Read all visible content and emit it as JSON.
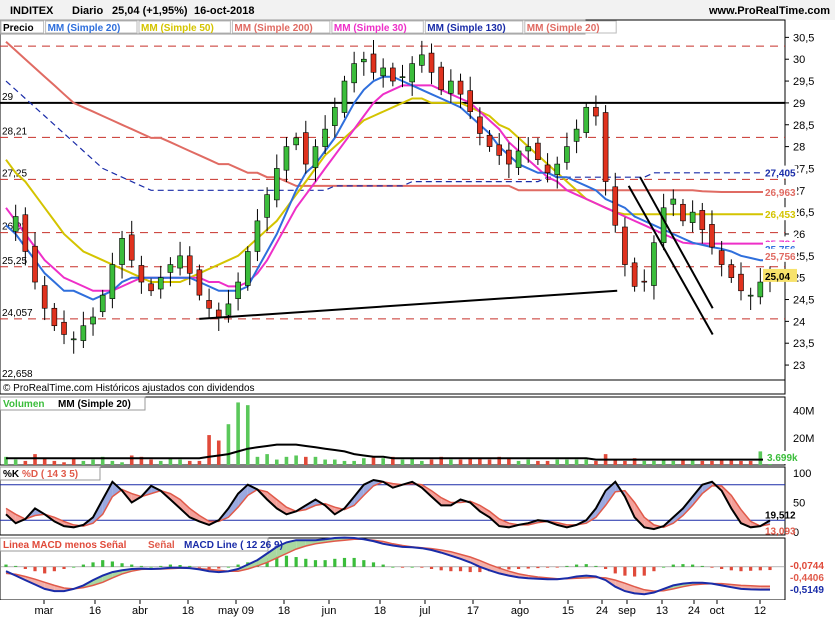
{
  "header": {
    "ticker": "INDITEX",
    "period": "Diario",
    "last": "25,04 (+1,95%)",
    "date": "16-oct-2018",
    "site": "www.ProRealTime.com"
  },
  "price_legend": [
    {
      "label": "Precio",
      "color": "#000000"
    },
    {
      "label": "MM (Simple 20)",
      "color": "#2f6fdc"
    },
    {
      "label": "MM (Simple 50)",
      "color": "#d4c400"
    },
    {
      "label": "MM (Simple 200)",
      "color": "#e06b63"
    },
    {
      "label": "MM (Simple 30)",
      "color": "#ee2fc8"
    },
    {
      "label": "MM (Simple 130)",
      "color": "#1a2ca8"
    },
    {
      "label": "MM (Simple 20)",
      "color": "#e06b63"
    }
  ],
  "footer_note": "© ProRealTime.com  Históricos ajustados con dividendos",
  "volume_legend": {
    "label": "Volumen",
    "ma": "MM (Simple 20)"
  },
  "stoch_legend": {
    "k": "%K",
    "d": "%D ( 14 3 5)"
  },
  "macd_legend": {
    "line1": "Linea MACD menos Señal",
    "line2": "Señal",
    "line3": "MACD Line ( 12 26 9)"
  },
  "chart_data": [
    {
      "type": "candlestick",
      "title": "INDITEX Diario",
      "ylim": [
        22.658,
        30.6
      ],
      "yticks": [
        "30,5",
        "30",
        "29,5",
        "29",
        "28,5",
        "28",
        "27,5",
        "27",
        "26,5",
        "26",
        "25,5",
        "25",
        "24,5",
        "24",
        "23,5",
        "23"
      ],
      "ytick_values": [
        30.5,
        30,
        29.5,
        29,
        28.5,
        28,
        27.5,
        27,
        26.5,
        26,
        25.5,
        25,
        24.5,
        24,
        23.5,
        23
      ],
      "xticks": [
        "mar",
        "16",
        "abr",
        "18",
        "may 09",
        "18",
        "jun",
        "18",
        "jul",
        "17",
        "ago",
        "15",
        "24",
        "sep",
        "13",
        "24",
        "oct",
        "12"
      ],
      "left_levels": [
        "29",
        "28,21",
        "27,25",
        "26,03",
        "25,25",
        "24,057",
        "22,658"
      ],
      "left_level_values": [
        29,
        28.21,
        27.25,
        26.03,
        25.25,
        24.057,
        22.658
      ],
      "dashed_levels": [
        30.3,
        29.0,
        28.21,
        27.25,
        26.03,
        25.25,
        24.057
      ],
      "right_labels": [
        {
          "text": "27,405",
          "value": 27.405,
          "color": "#1a2ca8"
        },
        {
          "text": "26,963",
          "value": 26.963,
          "color": "#e06b63"
        },
        {
          "text": "26,453",
          "value": 26.453,
          "color": "#d4c400"
        },
        {
          "text": "25,784",
          "value": 25.784,
          "color": "#ee2fc8"
        },
        {
          "text": "25,756",
          "value": 25.656,
          "color": "#2f6fdc"
        },
        {
          "text": "25,756",
          "value": 25.5,
          "color": "#e06b63"
        },
        {
          "text": "25,04",
          "value": 25.04,
          "color": "#000000"
        }
      ],
      "close_path": [
        26.1,
        26.4,
        25.6,
        24.9,
        24.3,
        23.9,
        23.7,
        23.6,
        23.9,
        24.1,
        24.6,
        25.3,
        25.9,
        25.4,
        24.9,
        24.7,
        25.0,
        25.3,
        25.5,
        25.1,
        24.6,
        24.3,
        24.1,
        24.4,
        24.9,
        25.6,
        26.3,
        26.9,
        27.5,
        28.0,
        28.2,
        27.6,
        28.0,
        28.4,
        28.9,
        29.5,
        29.9,
        30.0,
        29.7,
        29.8,
        29.5,
        29.6,
        29.9,
        30.1,
        29.7,
        29.3,
        29.5,
        29.2,
        28.8,
        28.3,
        28.0,
        27.8,
        27.6,
        27.9,
        28.0,
        27.7,
        27.4,
        27.6,
        28.0,
        28.4,
        28.9,
        28.7,
        27.2,
        26.2,
        25.3,
        24.8,
        24.9,
        25.8,
        26.6,
        26.8,
        26.3,
        26.5,
        26.1,
        25.7,
        25.3,
        25.0,
        24.7,
        24.6,
        24.9,
        25.04
      ],
      "ma20": [
        26.2,
        26.0,
        25.7,
        25.4,
        25.1,
        24.9,
        24.7,
        24.7,
        24.6,
        24.5,
        24.6,
        24.7,
        24.9,
        25.0,
        25.0,
        25.0,
        25.0,
        25.0,
        25.0,
        25.0,
        24.9,
        24.8,
        24.7,
        24.7,
        24.7,
        24.8,
        25.2,
        25.6,
        26.0,
        26.5,
        27.0,
        27.4,
        27.6,
        27.9,
        28.2,
        28.6,
        29.0,
        29.3,
        29.5,
        29.6,
        29.6,
        29.5,
        29.4,
        29.3,
        29.2,
        29.1,
        29.0,
        28.9,
        28.7,
        28.5,
        28.3,
        28.0,
        27.8,
        27.6,
        27.5,
        27.4,
        27.4,
        27.3,
        27.3,
        27.2,
        27.1,
        27.0,
        26.8,
        26.7,
        26.6,
        26.4,
        26.3,
        26.2,
        26.1,
        26.0,
        25.9,
        25.8,
        25.75,
        25.7,
        25.66,
        25.6,
        25.5,
        25.45,
        25.4,
        25.4
      ],
      "ma50": [
        27.7,
        27.4,
        27.2,
        26.9,
        26.6,
        26.3,
        26.0,
        25.8,
        25.6,
        25.5,
        25.4,
        25.3,
        25.2,
        25.1,
        25.0,
        24.9,
        24.9,
        24.9,
        24.9,
        25.0,
        25.1,
        25.2,
        25.3,
        25.4,
        25.5,
        25.7,
        25.9,
        26.1,
        26.3,
        26.6,
        26.9,
        27.2,
        27.5,
        27.8,
        28.0,
        28.2,
        28.4,
        28.6,
        28.7,
        28.8,
        28.9,
        29.0,
        29.1,
        29.1,
        29.0,
        29.0,
        29.0,
        29.0,
        28.9,
        28.8,
        28.7,
        28.5,
        28.4,
        28.2,
        28.0,
        27.8,
        27.6,
        27.4,
        27.2,
        27.0,
        26.8,
        26.7,
        26.6,
        26.5,
        26.45,
        26.45,
        26.45,
        26.45,
        26.45,
        26.45,
        26.45,
        26.45,
        26.45,
        26.45,
        26.45,
        26.45,
        26.45,
        26.45,
        26.45,
        26.45
      ],
      "ma200": [
        30.4,
        30.2,
        30.0,
        29.8,
        29.6,
        29.4,
        29.2,
        29.0,
        28.9,
        28.8,
        28.7,
        28.6,
        28.5,
        28.4,
        28.3,
        28.2,
        28.2,
        28.1,
        28.0,
        27.9,
        27.8,
        27.7,
        27.6,
        27.6,
        27.5,
        27.4,
        27.4,
        27.3,
        27.3,
        27.2,
        27.1,
        27.1,
        27.1,
        27.1,
        27.1,
        27.1,
        27.1,
        27.1,
        27.1,
        27.1,
        27.1,
        27.1,
        27.1,
        27.1,
        27.1,
        27.1,
        27.1,
        27.1,
        27.1,
        27.1,
        27.1,
        27.1,
        27.1,
        27.0,
        27.0,
        27.0,
        27.0,
        27.0,
        27.0,
        27.0,
        27.0,
        27.0,
        27.0,
        27.0,
        27.0,
        27.0,
        27.0,
        27.0,
        27.0,
        27.0,
        27.0,
        27.0,
        26.98,
        26.97,
        26.96,
        26.96,
        26.96,
        26.96,
        26.96,
        26.96
      ],
      "ma30": [
        26.6,
        26.3,
        26.0,
        25.7,
        25.4,
        25.2,
        25.0,
        24.9,
        24.8,
        24.7,
        24.7,
        24.7,
        24.8,
        24.9,
        25.0,
        25.0,
        25.0,
        25.0,
        25.0,
        25.0,
        25.0,
        24.9,
        24.9,
        24.8,
        24.8,
        24.9,
        25.1,
        25.4,
        25.8,
        26.2,
        26.6,
        26.9,
        27.2,
        27.5,
        27.8,
        28.1,
        28.4,
        28.7,
        29.0,
        29.2,
        29.3,
        29.4,
        29.4,
        29.4,
        29.4,
        29.3,
        29.2,
        29.1,
        29.0,
        28.8,
        28.6,
        28.4,
        28.1,
        27.9,
        27.7,
        27.5,
        27.3,
        27.2,
        27.0,
        26.9,
        26.8,
        26.7,
        26.6,
        26.5,
        26.4,
        26.3,
        26.2,
        26.1,
        26.0,
        25.9,
        25.8,
        25.78,
        25.78,
        25.78,
        25.78,
        25.78,
        25.78,
        25.78,
        25.78,
        25.78
      ],
      "ma130": [
        29.5,
        29.3,
        29.1,
        28.9,
        28.7,
        28.5,
        28.3,
        28.1,
        27.9,
        27.7,
        27.5,
        27.4,
        27.3,
        27.2,
        27.1,
        27.0,
        27.0,
        27.0,
        27.0,
        27.0,
        27.0,
        27.0,
        27.0,
        27.0,
        27.0,
        27.0,
        27.0,
        27.0,
        27.0,
        27.0,
        27.0,
        27.0,
        27.0,
        27.0,
        27.1,
        27.1,
        27.1,
        27.1,
        27.1,
        27.1,
        27.1,
        27.1,
        27.2,
        27.2,
        27.2,
        27.2,
        27.2,
        27.2,
        27.2,
        27.2,
        27.2,
        27.2,
        27.2,
        27.2,
        27.2,
        27.2,
        27.3,
        27.3,
        27.3,
        27.3,
        27.3,
        27.3,
        27.3,
        27.3,
        27.3,
        27.3,
        27.3,
        27.4,
        27.4,
        27.4,
        27.4,
        27.4,
        27.4,
        27.4,
        27.4,
        27.4,
        27.4,
        27.4,
        27.4,
        27.4
      ],
      "trendlines": [
        {
          "from": [
            0.253,
            24.057
          ],
          "to": [
            0.8,
            24.7
          ]
        },
        {
          "from": [
            0.83,
            27.3
          ],
          "to": [
            0.925,
            24.3
          ]
        },
        {
          "from": [
            0.815,
            27.1
          ],
          "to": [
            0.925,
            23.7
          ]
        }
      ]
    },
    {
      "type": "bar",
      "title": "Volumen",
      "yticks": [
        "40M",
        "20M"
      ],
      "ytick_values": [
        40,
        20
      ],
      "last_labels": [
        "3.699k"
      ],
      "ylim": [
        0,
        50
      ],
      "values": [
        6,
        4,
        3,
        8,
        5,
        3,
        2,
        5,
        3,
        4,
        6,
        3,
        2,
        7,
        6,
        4,
        3,
        5,
        4,
        3,
        3,
        22,
        18,
        30,
        46,
        44,
        6,
        8,
        4,
        6,
        7,
        6,
        6,
        4,
        4,
        3,
        3,
        5,
        6,
        5,
        6,
        4,
        5,
        3,
        4,
        6,
        4,
        4,
        5,
        5,
        4,
        6,
        5,
        3,
        4,
        3,
        3,
        4,
        4,
        4,
        4,
        3,
        8,
        4,
        3,
        5,
        3,
        3,
        4,
        3,
        4,
        4,
        3,
        3,
        4,
        4,
        3,
        3,
        10,
        4
      ],
      "ma_values": [
        5,
        5,
        5,
        5,
        5,
        5,
        5,
        5,
        5,
        5,
        5,
        5,
        5,
        5,
        5,
        5,
        5,
        5,
        5,
        5,
        5,
        6,
        7,
        8,
        10,
        12,
        13,
        14,
        15,
        15,
        15,
        14,
        13,
        12,
        11,
        10,
        8,
        7,
        6,
        6,
        5,
        5,
        5,
        5,
        5,
        5,
        5,
        5,
        5,
        5,
        5,
        5,
        5,
        5,
        5,
        5,
        5,
        5,
        5,
        5,
        5,
        4,
        4,
        4,
        4,
        4,
        4,
        4,
        4,
        4,
        4,
        4,
        4,
        4,
        4,
        4,
        4,
        4,
        4,
        4
      ]
    },
    {
      "type": "line",
      "title": "%K %D ( 14 3 5)",
      "ylim": [
        -5,
        110
      ],
      "yticks": [
        "100",
        "50",
        "0"
      ],
      "ytick_values": [
        100,
        50,
        0
      ],
      "hlines": [
        80,
        20
      ],
      "last_labels": [
        "19,512",
        "13,093"
      ],
      "k": [
        30,
        15,
        22,
        40,
        30,
        18,
        10,
        8,
        12,
        25,
        55,
        85,
        70,
        50,
        60,
        78,
        70,
        55,
        40,
        25,
        18,
        12,
        20,
        40,
        65,
        80,
        72,
        55,
        40,
        30,
        35,
        45,
        55,
        45,
        30,
        40,
        60,
        80,
        88,
        85,
        75,
        80,
        85,
        75,
        60,
        45,
        45,
        55,
        50,
        35,
        25,
        10,
        8,
        12,
        15,
        20,
        18,
        12,
        8,
        12,
        20,
        40,
        70,
        85,
        60,
        25,
        8,
        5,
        10,
        25,
        40,
        60,
        80,
        85,
        70,
        40,
        15,
        8,
        10,
        19.5
      ],
      "d": [
        40,
        30,
        22,
        28,
        30,
        25,
        18,
        12,
        10,
        15,
        30,
        60,
        72,
        65,
        60,
        65,
        70,
        65,
        55,
        40,
        28,
        18,
        18,
        25,
        42,
        62,
        72,
        68,
        55,
        42,
        35,
        38,
        45,
        48,
        42,
        38,
        45,
        62,
        78,
        85,
        82,
        80,
        82,
        80,
        70,
        58,
        50,
        50,
        52,
        45,
        35,
        22,
        15,
        12,
        12,
        16,
        18,
        16,
        12,
        12,
        15,
        25,
        45,
        68,
        70,
        50,
        25,
        12,
        8,
        15,
        28,
        45,
        65,
        78,
        78,
        62,
        38,
        18,
        10,
        13.1
      ]
    },
    {
      "type": "line",
      "title": "MACD Line ( 12 26 9)",
      "ylim": [
        -0.75,
        0.65
      ],
      "last_labels": [
        "-0,0744",
        "-0,4406",
        "-0,5149"
      ],
      "hist": [
        0.05,
        0.02,
        -0.05,
        -0.1,
        -0.15,
        -0.1,
        -0.05,
        0.0,
        0.05,
        0.1,
        0.15,
        0.12,
        0.08,
        0.05,
        0.02,
        0.0,
        0.02,
        0.05,
        0.04,
        0.02,
        -0.02,
        -0.05,
        -0.04,
        0.0,
        0.05,
        0.1,
        0.15,
        0.2,
        0.25,
        0.25,
        0.22,
        0.18,
        0.15,
        0.15,
        0.18,
        0.2,
        0.2,
        0.15,
        0.1,
        0.05,
        0.0,
        -0.02,
        0.0,
        -0.02,
        -0.05,
        -0.08,
        -0.1,
        -0.1,
        -0.12,
        -0.12,
        -0.1,
        -0.08,
        -0.06,
        -0.05,
        -0.04,
        -0.03,
        -0.02,
        -0.01,
        0.02,
        0.05,
        0.06,
        0.02,
        -0.05,
        -0.15,
        -0.2,
        -0.22,
        -0.2,
        -0.1,
        0.0,
        0.05,
        0.06,
        0.05,
        0.02,
        -0.02,
        -0.05,
        -0.08,
        -0.1,
        -0.09,
        -0.08,
        -0.074
      ],
      "macd": [
        -0.1,
        -0.2,
        -0.3,
        -0.4,
        -0.5,
        -0.55,
        -0.55,
        -0.5,
        -0.42,
        -0.3,
        -0.2,
        -0.12,
        -0.08,
        -0.05,
        -0.04,
        -0.05,
        -0.04,
        -0.02,
        -0.02,
        -0.03,
        -0.06,
        -0.1,
        -0.12,
        -0.1,
        -0.05,
        0.05,
        0.15,
        0.3,
        0.45,
        0.55,
        0.6,
        0.6,
        0.6,
        0.62,
        0.65,
        0.66,
        0.65,
        0.62,
        0.58,
        0.52,
        0.48,
        0.45,
        0.44,
        0.42,
        0.38,
        0.32,
        0.25,
        0.18,
        0.1,
        0.0,
        -0.08,
        -0.15,
        -0.2,
        -0.24,
        -0.26,
        -0.27,
        -0.28,
        -0.28,
        -0.26,
        -0.22,
        -0.2,
        -0.22,
        -0.3,
        -0.45,
        -0.55,
        -0.6,
        -0.62,
        -0.58,
        -0.5,
        -0.42,
        -0.38,
        -0.36,
        -0.36,
        -0.38,
        -0.42,
        -0.46,
        -0.5,
        -0.51,
        -0.515,
        -0.515
      ],
      "signal": [
        -0.15,
        -0.17,
        -0.22,
        -0.28,
        -0.35,
        -0.42,
        -0.48,
        -0.5,
        -0.47,
        -0.42,
        -0.35,
        -0.25,
        -0.16,
        -0.1,
        -0.06,
        -0.05,
        -0.05,
        -0.04,
        -0.03,
        -0.03,
        -0.04,
        -0.06,
        -0.08,
        -0.1,
        -0.1,
        -0.05,
        0.02,
        0.1,
        0.2,
        0.3,
        0.4,
        0.47,
        0.52,
        0.55,
        0.58,
        0.6,
        0.62,
        0.62,
        0.6,
        0.57,
        0.52,
        0.48,
        0.45,
        0.43,
        0.41,
        0.38,
        0.34,
        0.28,
        0.22,
        0.14,
        0.05,
        -0.03,
        -0.1,
        -0.16,
        -0.2,
        -0.23,
        -0.25,
        -0.27,
        -0.27,
        -0.26,
        -0.25,
        -0.24,
        -0.25,
        -0.3,
        -0.37,
        -0.45,
        -0.52,
        -0.55,
        -0.54,
        -0.5,
        -0.45,
        -0.41,
        -0.39,
        -0.38,
        -0.38,
        -0.4,
        -0.42,
        -0.43,
        -0.44,
        -0.44
      ]
    }
  ]
}
